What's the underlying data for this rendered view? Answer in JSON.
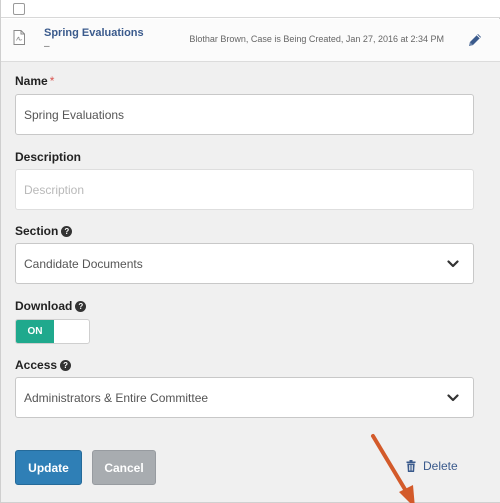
{
  "header": {
    "title": "Spring Evaluations",
    "subtitle": "–",
    "meta": "Blothar Brown, Case is Being Created, Jan 27, 2016 at 2:34 PM"
  },
  "form": {
    "name_label": "Name",
    "name_required": "*",
    "name_value": "Spring Evaluations",
    "description_label": "Description",
    "description_placeholder": "Description",
    "section_label": "Section",
    "section_value": "Candidate Documents",
    "download_label": "Download",
    "download_toggle": "ON",
    "access_label": "Access",
    "access_value": "Administrators & Entire Committee"
  },
  "actions": {
    "update_label": "Update",
    "cancel_label": "Cancel",
    "delete_label": "Delete"
  },
  "colors": {
    "primary": "#2f7fb6",
    "toggle_on": "#1fa98d",
    "arrow": "#d35a2a",
    "link": "#3a5a8c"
  }
}
